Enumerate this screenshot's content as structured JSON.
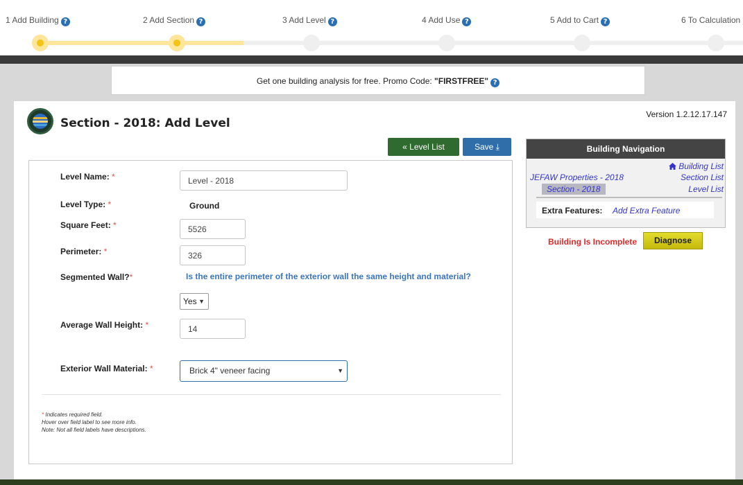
{
  "wizard": {
    "steps": [
      {
        "label": "1 Add Building",
        "state": "done"
      },
      {
        "label": "2 Add Section",
        "state": "done"
      },
      {
        "label": "3 Add Level",
        "state": "pending"
      },
      {
        "label": "4 Add Use",
        "state": "pending"
      },
      {
        "label": "5 Add to Cart",
        "state": "pending"
      },
      {
        "label": "6 To Calculation",
        "state": "pending"
      }
    ],
    "help_glyph": "?"
  },
  "promo": {
    "text": "Get one building analysis for free. Promo Code: ",
    "code": "\"FIRSTFREE\""
  },
  "header": {
    "version": "Version 1.2.12.17.147",
    "title": "Section - 2018: Add Level"
  },
  "toolbar": {
    "level_list_label": "« Level List",
    "save_label": "Save ⤓"
  },
  "form": {
    "required_mark": "*",
    "level_name": {
      "label": "Level Name:",
      "value": "Level - 2018"
    },
    "level_type": {
      "label": "Level Type:",
      "value": "Ground"
    },
    "square_feet": {
      "label": "Square Feet:",
      "value": "5526"
    },
    "perimeter": {
      "label": "Perimeter:",
      "value": "326"
    },
    "segmented_wall": {
      "label": "Segmented Wall?",
      "question": "Is the entire perimeter of the exterior wall the same height and material?",
      "value": "Yes"
    },
    "avg_wall_height": {
      "label": "Average Wall Height:",
      "value": "14"
    },
    "exterior_wall_material": {
      "label": "Exterior Wall Material:",
      "value": "Brick 4\" veneer facing"
    },
    "footnotes": {
      "required_note": " Indicates required field.",
      "hover_note": "Hover over field label to see more info.",
      "desc_note": "Note: Not all field labels have descriptions."
    }
  },
  "navigation": {
    "title": "Building Navigation",
    "building_list": "Building List",
    "properties": "JEFAW Properties - 2018",
    "section_list": "Section List",
    "section": "Section - 2018",
    "level_list": "Level List",
    "extra_features_label": "Extra Features:",
    "add_extra_feature": "Add Extra Feature",
    "status": "Building Is Incomplete",
    "diagnose_label": "Diagnose"
  },
  "colors": {
    "progress_done": "#fde59a",
    "progress_dot": "#f3c316",
    "green_button": "#2f6a2f",
    "blue_button": "#2f6ea8",
    "required": "#d9534f",
    "status_error": "#e02a2a",
    "link": "#3434c8"
  }
}
